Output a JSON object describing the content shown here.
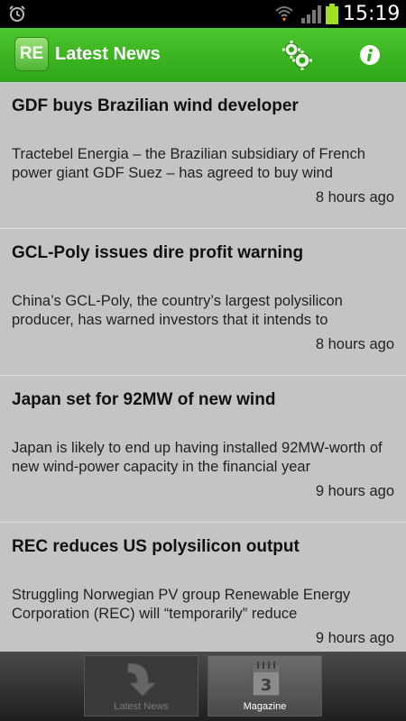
{
  "status_bar": {
    "time": "15:19",
    "icons": [
      "alarm-icon",
      "wifi-icon",
      "signal-icon",
      "battery-icon"
    ]
  },
  "action_bar": {
    "logo_text": "RE",
    "title": "Latest News",
    "icons": [
      "settings-icon",
      "info-icon"
    ],
    "accent_color": "#36ad1e"
  },
  "articles": [
    {
      "title": "GDF buys Brazilian wind developer",
      "snippet": "Tractebel Energia – the Brazilian subsidiary of French power giant GDF Suez – has agreed to buy wind",
      "time": "8 hours ago"
    },
    {
      "title": "GCL-Poly issues dire profit warning",
      "snippet": "China’s GCL-Poly, the country’s largest polysilicon producer, has warned investors that it intends to",
      "time": "8 hours ago"
    },
    {
      "title": "Japan set for 92MW of new wind",
      "snippet": "Japan is likely to end up having installed 92MW-worth of new wind-power capacity in the financial year",
      "time": "9 hours ago"
    },
    {
      "title": "REC reduces US polysilicon output",
      "snippet": "Struggling Norwegian PV group Renewable Energy Corporation (REC) will “temporarily” reduce",
      "time": "9 hours ago"
    }
  ],
  "tabs": [
    {
      "label": "Latest News",
      "icon": "down-arrow-icon",
      "selected": false
    },
    {
      "label": "Magazine",
      "icon": "calendar-icon",
      "calendar_day": "3",
      "selected": true
    }
  ]
}
